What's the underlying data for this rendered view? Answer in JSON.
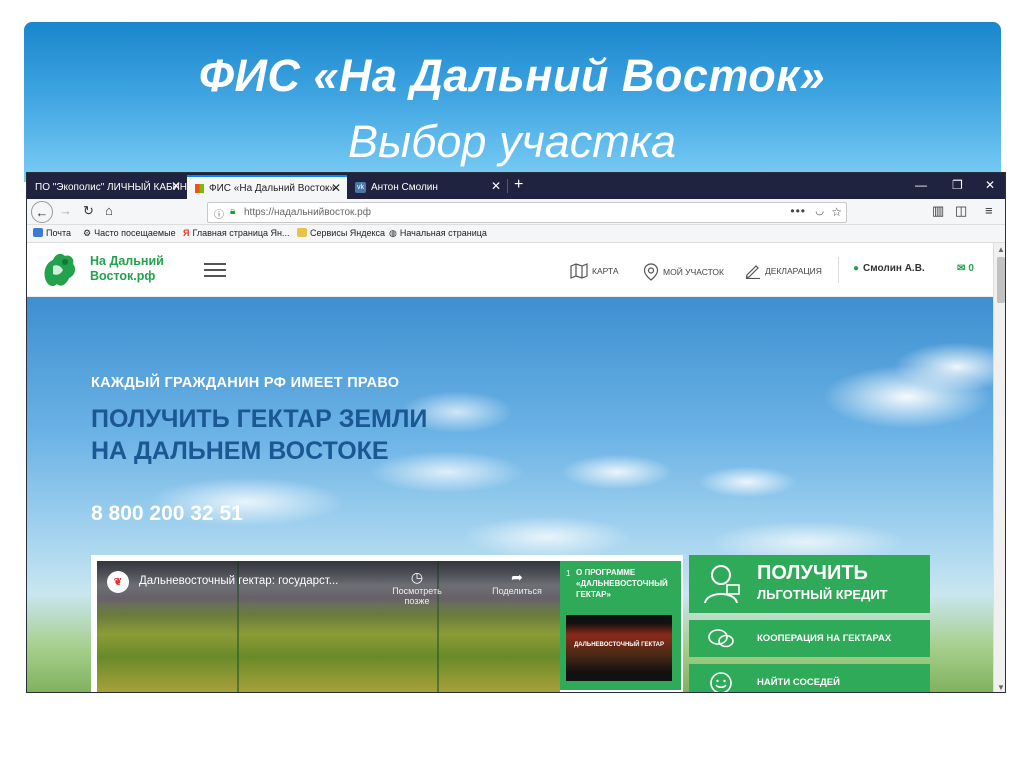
{
  "slide": {
    "title": "ФИС «На Дальний Восток»",
    "subtitle": "Выбор участка"
  },
  "browser": {
    "tabs": [
      {
        "label": "ПО \"Экополис\" ЛИЧНЫЙ КАБИНЕ"
      },
      {
        "label": "ФИС «На Дальний Восток»"
      },
      {
        "label": "Антон Смолин"
      }
    ],
    "url": "https://надальнийвосток.рф",
    "bookmarks": [
      "Почта",
      "Часто посещаемые",
      "Главная страница Ян...",
      "Сервисы Яндекса",
      "Начальная страница"
    ]
  },
  "site": {
    "logo_line1": "На Дальний",
    "logo_line2": "Восток.рф",
    "nav": {
      "map": "КАРТА",
      "my_plot": "МОЙ УЧАСТОК",
      "declaration": "ДЕКЛАРАЦИЯ"
    },
    "user": "Смолин А.В.",
    "mail_count": "0",
    "hero": {
      "kicker": "КАЖДЫЙ ГРАЖДАНИН РФ ИМЕЕТ ПРАВО",
      "heading_line1": "ПОЛУЧИТЬ ГЕКТАР ЗЕМЛИ",
      "heading_line2": "НА ДАЛЬНЕМ ВОСТОКЕ",
      "phone": "8 800 200 32 51"
    },
    "video": {
      "title": "Дальневосточный гектар: государст...",
      "watch_later": "Посмотреть позже",
      "share": "Поделиться",
      "playlist_num": "1",
      "playlist_title": "О ПРОГРАММЕ «ДАЛЬНЕВОСТОЧНЫЙ ГЕКТАР»",
      "thumb_text": "ДАЛЬНЕВОСТОЧНЫЙ ГЕКТАР"
    },
    "cta": {
      "credit_line1": "ПОЛУЧИТЬ",
      "credit_line2": "ЛЬГОТНЫЙ КРЕДИТ",
      "coop": "КООПЕРАЦИЯ НА ГЕКТАРАХ",
      "neighbors": "НАЙТИ СОСЕДЕЙ"
    }
  },
  "colors": {
    "brand_green": "#2faa58",
    "hero_heading": "#1a5793",
    "header_blue": "#1a86cc"
  }
}
